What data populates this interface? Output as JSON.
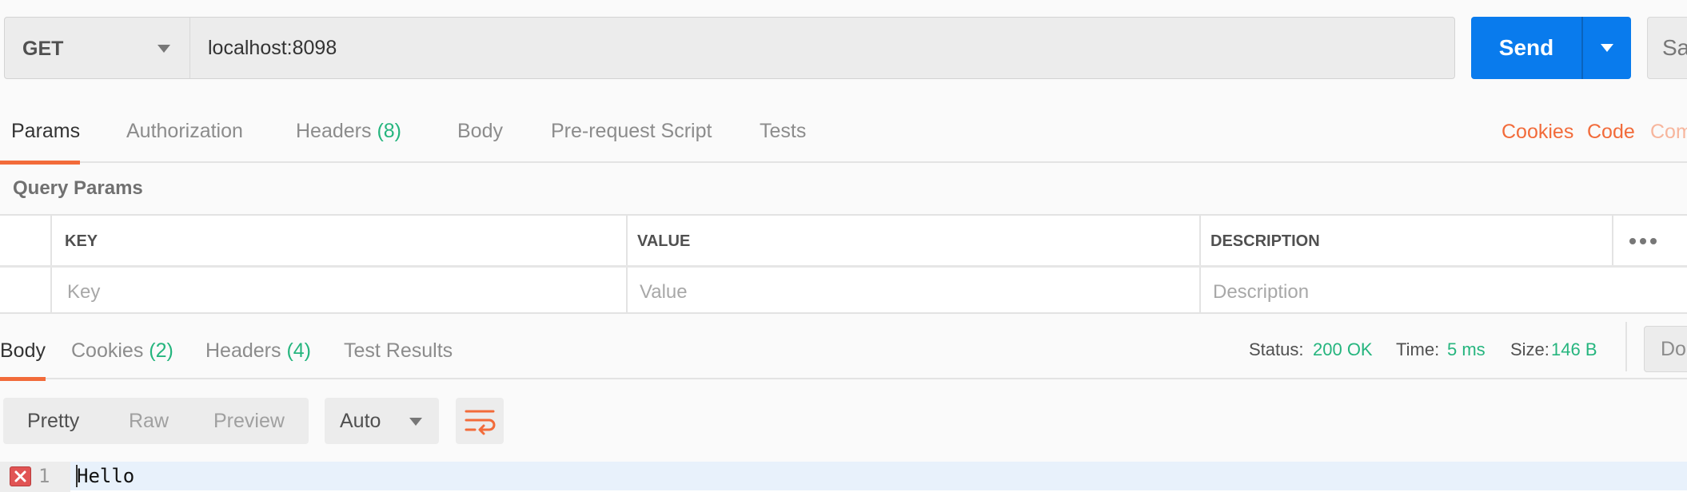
{
  "request": {
    "method": "GET",
    "url": "localhost:8098",
    "send_label": "Send",
    "save_label": "Sa"
  },
  "request_tabs": [
    {
      "label": "Params",
      "active": true
    },
    {
      "label": "Authorization"
    },
    {
      "label": "Headers",
      "count": "(8)"
    },
    {
      "label": "Body"
    },
    {
      "label": "Pre-request Script"
    },
    {
      "label": "Tests"
    }
  ],
  "right_links": {
    "cookies": "Cookies",
    "code": "Code",
    "comments": "Com"
  },
  "query_params": {
    "title": "Query Params",
    "columns": [
      "KEY",
      "VALUE",
      "DESCRIPTION"
    ],
    "placeholders": [
      "Key",
      "Value",
      "Description"
    ]
  },
  "response_tabs": [
    {
      "label": "Body",
      "active": true
    },
    {
      "label": "Cookies",
      "count": "(2)"
    },
    {
      "label": "Headers",
      "count": "(4)"
    },
    {
      "label": "Test Results"
    }
  ],
  "response_meta": {
    "status_label": "Status:",
    "status_value": "200 OK",
    "time_label": "Time:",
    "time_value": "5 ms",
    "size_label": "Size:",
    "size_value": "146 B",
    "download_label": "Do"
  },
  "view_modes": [
    "Pretty",
    "Raw",
    "Preview"
  ],
  "format": "Auto",
  "editor": {
    "line_number": "1",
    "text": "Hello"
  },
  "colors": {
    "accent": "#f26b3a",
    "send": "#097bed",
    "success": "#25b57e"
  },
  "icons": {
    "more": "more-horizontal-icon",
    "wrap": "wrap-lines-icon",
    "error": "error-icon"
  }
}
